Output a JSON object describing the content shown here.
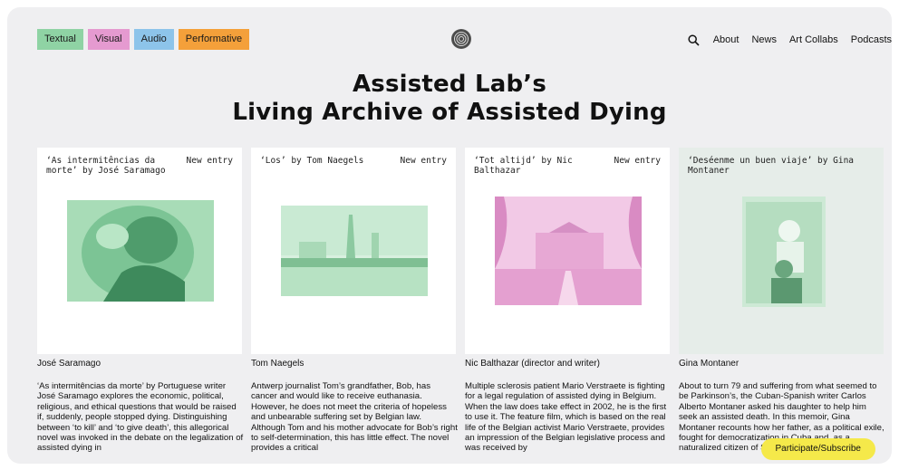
{
  "categories": [
    {
      "label": "Textual",
      "color": "#8fd3a4"
    },
    {
      "label": "Visual",
      "color": "#e59ad0"
    },
    {
      "label": "Audio",
      "color": "#8dc4ea"
    },
    {
      "label": "Performative",
      "color": "#f4a03a"
    }
  ],
  "nav": {
    "search_icon": "search-icon",
    "items": [
      "About",
      "News",
      "Art Collabs",
      "Podcasts"
    ]
  },
  "title": {
    "line1": "Assisted Lab’s",
    "line2": "Living Archive of Assisted Dying"
  },
  "cards": [
    {
      "title": "‘As intermitências da morte’ by José Saramago",
      "tag": "New entry",
      "tint": "#8fd3a4",
      "author": "José Saramago",
      "description": "‘As intermitências da morte’ by Portuguese writer José Saramago explores the economic, political, religious, and ethical questions that would be raised if, suddenly, people stopped dying. Distinguishing between ‘to kill’ and ‘to give death’, this allegorical novel was invoked in the debate on the legalization of assisted dying in"
    },
    {
      "title": "‘Los’ by Tom Naegels",
      "tag": "New entry",
      "tint": "#8fd3a4",
      "author": "Tom Naegels",
      "description": "Antwerp journalist Tom’s grandfather, Bob, has cancer and would like to receive euthanasia. However, he does not meet the criteria of hopeless and unbearable suffering set by Belgian law. Although Tom and his mother advocate for Bob’s right to self-determination, this has little effect. The novel provides a critical"
    },
    {
      "title": "‘Tot altijd’ by Nic Balthazar",
      "tag": "New entry",
      "tint": "#e59ad0",
      "author": "Nic Balthazar (director and writer)",
      "description": "Multiple sclerosis patient Mario Verstraete is fighting for a legal regulation of assisted dying in Belgium. When the law does take effect in 2002, he is the first to use it. The feature film, which is based on the real life of the Belgian activist Mario Verstraete, provides an impression of the Belgian legislative process and was received by"
    },
    {
      "title": "‘Deséenme un buen viaje’ by Gina Montaner",
      "tag": "",
      "tint": "#8fd3a4",
      "author": "Gina Montaner",
      "description": "About to turn 79 and suffering from what seemed to be Parkinson’s, the Cuban-Spanish writer Carlos Alberto Montaner asked his daughter to help him seek an assisted death. In this memoir, Gina Montaner recounts how her father, as a political exile, fought for democratization in Cuba and, as a naturalized citizen of Spain"
    }
  ],
  "subscribe_label": "Participate/Subscribe"
}
